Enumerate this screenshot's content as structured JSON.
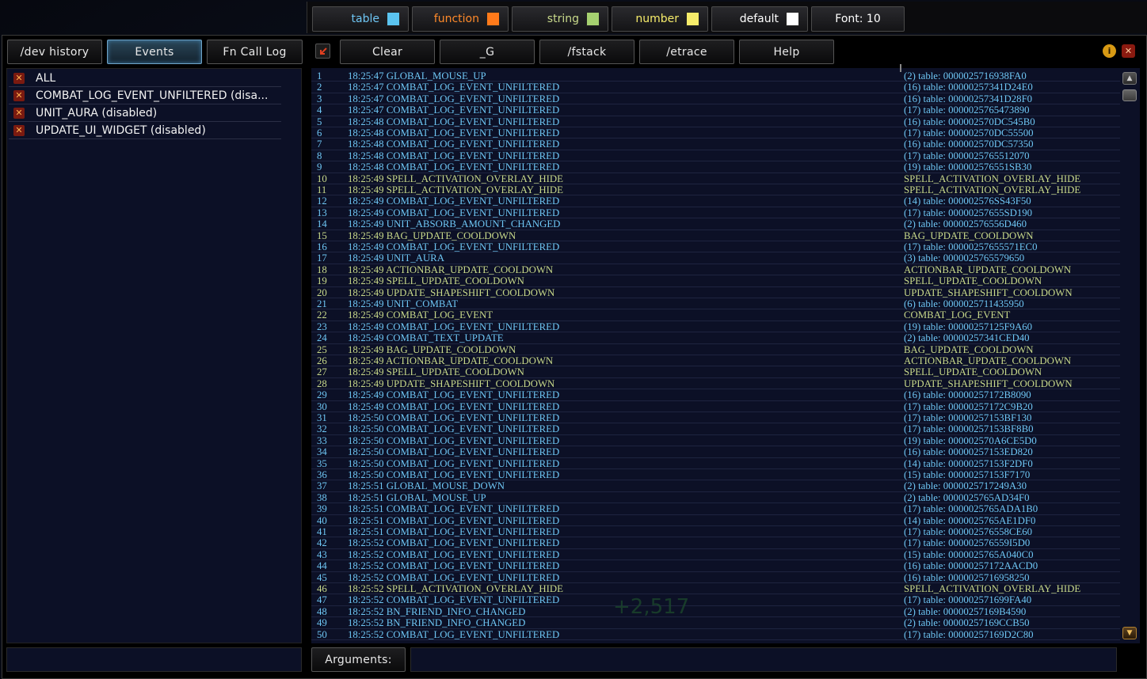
{
  "legend": [
    {
      "label": "table",
      "color": "#5bc4f0",
      "text_color": "#6ec6f4"
    },
    {
      "label": "function",
      "color": "#ff7a1a",
      "text_color": "#ff8a2a"
    },
    {
      "label": "string",
      "color": "#a6d170",
      "text_color": "#c8d98a"
    },
    {
      "label": "number",
      "color": "#f6ec6a",
      "text_color": "#f6ec6a"
    },
    {
      "label": "default",
      "color": "#ffffff",
      "text_color": "#ffffff"
    }
  ],
  "font_label": "Font: 10",
  "tabs": {
    "dev_history": "/dev history",
    "events": "Events",
    "fn_call_log": "Fn Call Log"
  },
  "toolbar": {
    "clear": "Clear",
    "g": "_G",
    "fstack": "/fstack",
    "etrace": "/etrace",
    "help": "Help"
  },
  "arguments_label": "Arguments:",
  "watermark": "+2,517",
  "events_list": [
    "ALL",
    "COMBAT_LOG_EVENT_UNFILTERED (disa...",
    "UNIT_AURA (disabled)",
    "UPDATE_UI_WIDGET (disabled)"
  ],
  "log": [
    {
      "n": "1",
      "time": "18:25:47",
      "event": "GLOBAL_MOUSE_UP",
      "args": "(2) table: 0000025716938FA0",
      "etype": "table",
      "atype": "table"
    },
    {
      "n": "2",
      "time": "18:25:47",
      "event": "COMBAT_LOG_EVENT_UNFILTERED",
      "args": "(16) table: 00000257341D24E0",
      "etype": "table",
      "atype": "table"
    },
    {
      "n": "3",
      "time": "18:25:47",
      "event": "COMBAT_LOG_EVENT_UNFILTERED",
      "args": "(16) table: 00000257341D28F0",
      "etype": "table",
      "atype": "table"
    },
    {
      "n": "4",
      "time": "18:25:47",
      "event": "COMBAT_LOG_EVENT_UNFILTERED",
      "args": "(17) table: 0000025765473890",
      "etype": "table",
      "atype": "table"
    },
    {
      "n": "5",
      "time": "18:25:48",
      "event": "COMBAT_LOG_EVENT_UNFILTERED",
      "args": "(16) table: 000002570DC545B0",
      "etype": "table",
      "atype": "table"
    },
    {
      "n": "6",
      "time": "18:25:48",
      "event": "COMBAT_LOG_EVENT_UNFILTERED",
      "args": "(17) table: 000002570DC55500",
      "etype": "table",
      "atype": "table"
    },
    {
      "n": "7",
      "time": "18:25:48",
      "event": "COMBAT_LOG_EVENT_UNFILTERED",
      "args": "(16) table: 000002570DC57350",
      "etype": "table",
      "atype": "table"
    },
    {
      "n": "8",
      "time": "18:25:48",
      "event": "COMBAT_LOG_EVENT_UNFILTERED",
      "args": "(17) table: 0000025765512070",
      "etype": "table",
      "atype": "table"
    },
    {
      "n": "9",
      "time": "18:25:48",
      "event": "COMBAT_LOG_EVENT_UNFILTERED",
      "args": "(19) table: 000002576551SB30",
      "etype": "table",
      "atype": "table"
    },
    {
      "n": "10",
      "time": "18:25:49",
      "event": "SPELL_ACTIVATION_OVERLAY_HIDE",
      "args": "SPELL_ACTIVATION_OVERLAY_HIDE",
      "etype": "string",
      "atype": "string"
    },
    {
      "n": "11",
      "time": "18:25:49",
      "event": "SPELL_ACTIVATION_OVERLAY_HIDE",
      "args": "SPELL_ACTIVATION_OVERLAY_HIDE",
      "etype": "string",
      "atype": "string"
    },
    {
      "n": "12",
      "time": "18:25:49",
      "event": "COMBAT_LOG_EVENT_UNFILTERED",
      "args": "(14) table: 000002576SS43F50",
      "etype": "table",
      "atype": "table"
    },
    {
      "n": "13",
      "time": "18:25:49",
      "event": "COMBAT_LOG_EVENT_UNFILTERED",
      "args": "(17) table: 00000257655SD190",
      "etype": "table",
      "atype": "table"
    },
    {
      "n": "14",
      "time": "18:25:49",
      "event": "UNIT_ABSORB_AMOUNT_CHANGED",
      "args": "(2) table: 000002576556D460",
      "etype": "table",
      "atype": "table"
    },
    {
      "n": "15",
      "time": "18:25:49",
      "event": "BAG_UPDATE_COOLDOWN",
      "args": "BAG_UPDATE_COOLDOWN",
      "etype": "string",
      "atype": "string"
    },
    {
      "n": "16",
      "time": "18:25:49",
      "event": "COMBAT_LOG_EVENT_UNFILTERED",
      "args": "(17) table: 00000257655571EC0",
      "etype": "table",
      "atype": "table"
    },
    {
      "n": "17",
      "time": "18:25:49",
      "event": "UNIT_AURA",
      "args": "(3) table: 0000025765579650",
      "etype": "table",
      "atype": "table"
    },
    {
      "n": "18",
      "time": "18:25:49",
      "event": "ACTIONBAR_UPDATE_COOLDOWN",
      "args": "ACTIONBAR_UPDATE_COOLDOWN",
      "etype": "string",
      "atype": "string"
    },
    {
      "n": "19",
      "time": "18:25:49",
      "event": "SPELL_UPDATE_COOLDOWN",
      "args": "SPELL_UPDATE_COOLDOWN",
      "etype": "string",
      "atype": "string"
    },
    {
      "n": "20",
      "time": "18:25:49",
      "event": "UPDATE_SHAPESHIFT_COOLDOWN",
      "args": "UPDATE_SHAPESHIFT_COOLDOWN",
      "etype": "string",
      "atype": "string"
    },
    {
      "n": "21",
      "time": "18:25:49",
      "event": "UNIT_COMBAT",
      "args": "(6) table: 0000025711435950",
      "etype": "table",
      "atype": "table"
    },
    {
      "n": "22",
      "time": "18:25:49",
      "event": "COMBAT_LOG_EVENT",
      "args": "COMBAT_LOG_EVENT",
      "etype": "string",
      "atype": "string"
    },
    {
      "n": "23",
      "time": "18:25:49",
      "event": "COMBAT_LOG_EVENT_UNFILTERED",
      "args": "(19) table: 00000257125F9A60",
      "etype": "table",
      "atype": "table"
    },
    {
      "n": "24",
      "time": "18:25:49",
      "event": "COMBAT_TEXT_UPDATE",
      "args": "(2) table: 00000257341CED40",
      "etype": "table",
      "atype": "table"
    },
    {
      "n": "25",
      "time": "18:25:49",
      "event": "BAG_UPDATE_COOLDOWN",
      "args": "BAG_UPDATE_COOLDOWN",
      "etype": "string",
      "atype": "string"
    },
    {
      "n": "26",
      "time": "18:25:49",
      "event": "ACTIONBAR_UPDATE_COOLDOWN",
      "args": "ACTIONBAR_UPDATE_COOLDOWN",
      "etype": "string",
      "atype": "string"
    },
    {
      "n": "27",
      "time": "18:25:49",
      "event": "SPELL_UPDATE_COOLDOWN",
      "args": "SPELL_UPDATE_COOLDOWN",
      "etype": "string",
      "atype": "string"
    },
    {
      "n": "28",
      "time": "18:25:49",
      "event": "UPDATE_SHAPESHIFT_COOLDOWN",
      "args": "UPDATE_SHAPESHIFT_COOLDOWN",
      "etype": "string",
      "atype": "string"
    },
    {
      "n": "29",
      "time": "18:25:49",
      "event": "COMBAT_LOG_EVENT_UNFILTERED",
      "args": "(16) table: 00000257172B8090",
      "etype": "table",
      "atype": "table"
    },
    {
      "n": "30",
      "time": "18:25:49",
      "event": "COMBAT_LOG_EVENT_UNFILTERED",
      "args": "(17) table: 00000257172C9B20",
      "etype": "table",
      "atype": "table"
    },
    {
      "n": "31",
      "time": "18:25:50",
      "event": "COMBAT_LOG_EVENT_UNFILTERED",
      "args": "(17) table: 00000257153BF130",
      "etype": "table",
      "atype": "table"
    },
    {
      "n": "32",
      "time": "18:25:50",
      "event": "COMBAT_LOG_EVENT_UNFILTERED",
      "args": "(17) table: 00000257153BF8B0",
      "etype": "table",
      "atype": "table"
    },
    {
      "n": "33",
      "time": "18:25:50",
      "event": "COMBAT_LOG_EVENT_UNFILTERED",
      "args": "(19) table: 000002570A6CE5D0",
      "etype": "table",
      "atype": "table"
    },
    {
      "n": "34",
      "time": "18:25:50",
      "event": "COMBAT_LOG_EVENT_UNFILTERED",
      "args": "(16) table: 00000257153ED820",
      "etype": "table",
      "atype": "table"
    },
    {
      "n": "35",
      "time": "18:25:50",
      "event": "COMBAT_LOG_EVENT_UNFILTERED",
      "args": "(14) table: 00000257153F2DF0",
      "etype": "table",
      "atype": "table"
    },
    {
      "n": "36",
      "time": "18:25:50",
      "event": "COMBAT_LOG_EVENT_UNFILTERED",
      "args": "(15) table: 00000257153F7170",
      "etype": "table",
      "atype": "table"
    },
    {
      "n": "37",
      "time": "18:25:51",
      "event": "GLOBAL_MOUSE_DOWN",
      "args": "(2) table: 0000025717249A30",
      "etype": "table",
      "atype": "table"
    },
    {
      "n": "38",
      "time": "18:25:51",
      "event": "GLOBAL_MOUSE_UP",
      "args": "(2) table: 0000025765AD34F0",
      "etype": "table",
      "atype": "table"
    },
    {
      "n": "39",
      "time": "18:25:51",
      "event": "COMBAT_LOG_EVENT_UNFILTERED",
      "args": "(17) table: 0000025765ADA1B0",
      "etype": "table",
      "atype": "table"
    },
    {
      "n": "40",
      "time": "18:25:51",
      "event": "COMBAT_LOG_EVENT_UNFILTERED",
      "args": "(14) table: 0000025765AE1DF0",
      "etype": "table",
      "atype": "table"
    },
    {
      "n": "41",
      "time": "18:25:51",
      "event": "COMBAT_LOG_EVENT_UNFILTERED",
      "args": "(17) table: 000002576558CE60",
      "etype": "table",
      "atype": "table"
    },
    {
      "n": "42",
      "time": "18:25:52",
      "event": "COMBAT_LOG_EVENT_UNFILTERED",
      "args": "(17) table: 000002576559I5D0",
      "etype": "table",
      "atype": "table"
    },
    {
      "n": "43",
      "time": "18:25:52",
      "event": "COMBAT_LOG_EVENT_UNFILTERED",
      "args": "(15) table: 0000025765A040C0",
      "etype": "table",
      "atype": "table"
    },
    {
      "n": "44",
      "time": "18:25:52",
      "event": "COMBAT_LOG_EVENT_UNFILTERED",
      "args": "(16) table: 00000257172AACD0",
      "etype": "table",
      "atype": "table"
    },
    {
      "n": "45",
      "time": "18:25:52",
      "event": "COMBAT_LOG_EVENT_UNFILTERED",
      "args": "(16) table: 0000025716958250",
      "etype": "table",
      "atype": "table"
    },
    {
      "n": "46",
      "time": "18:25:52",
      "event": "SPELL_ACTIVATION_OVERLAY_HIDE",
      "args": "SPELL_ACTIVATION_OVERLAY_HIDE",
      "etype": "string",
      "atype": "string"
    },
    {
      "n": "47",
      "time": "18:25:52",
      "event": "COMBAT_LOG_EVENT_UNFILTERED",
      "args": "(17) table: 000002571699FA40",
      "etype": "table",
      "atype": "table"
    },
    {
      "n": "48",
      "time": "18:25:52",
      "event": "BN_FRIEND_INFO_CHANGED",
      "args": "(2) table: 00000257169B4590",
      "etype": "table",
      "atype": "table"
    },
    {
      "n": "49",
      "time": "18:25:52",
      "event": "BN_FRIEND_INFO_CHANGED",
      "args": "(2) table: 00000257169CCB50",
      "etype": "table",
      "atype": "table"
    },
    {
      "n": "50",
      "time": "18:25:52",
      "event": "COMBAT_LOG_EVENT_UNFILTERED",
      "args": "(17) table: 00000257169D2C80",
      "etype": "table",
      "atype": "table"
    }
  ]
}
